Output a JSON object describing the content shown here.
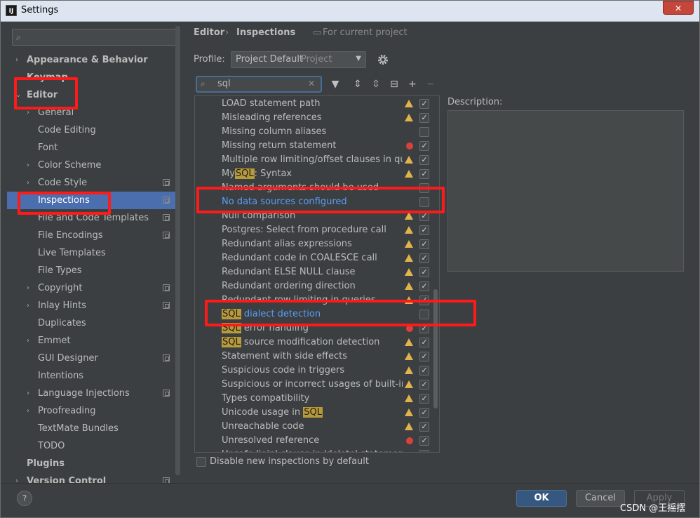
{
  "window": {
    "title": "Settings",
    "logo": "IJ",
    "close": "✕"
  },
  "sidebar": {
    "search_placeholder": "",
    "items": [
      {
        "label": "Appearance & Behavior",
        "level": 0,
        "arrow": "›",
        "bold": true
      },
      {
        "label": "Keymap",
        "level": 0,
        "bold": true
      },
      {
        "label": "Editor",
        "level": 0,
        "arrow": "⌄",
        "bold": true
      },
      {
        "label": "General",
        "level": 1,
        "arrow": "›"
      },
      {
        "label": "Code Editing",
        "level": 1
      },
      {
        "label": "Font",
        "level": 1
      },
      {
        "label": "Color Scheme",
        "level": 1,
        "arrow": "›"
      },
      {
        "label": "Code Style",
        "level": 1,
        "arrow": "›",
        "project": true
      },
      {
        "label": "Inspections",
        "level": 1,
        "project": true,
        "selected": true
      },
      {
        "label": "File and Code Templates",
        "level": 1,
        "project": true
      },
      {
        "label": "File Encodings",
        "level": 1,
        "project": true
      },
      {
        "label": "Live Templates",
        "level": 1
      },
      {
        "label": "File Types",
        "level": 1
      },
      {
        "label": "Copyright",
        "level": 1,
        "arrow": "›",
        "project": true
      },
      {
        "label": "Inlay Hints",
        "level": 1,
        "arrow": "›",
        "project": true
      },
      {
        "label": "Duplicates",
        "level": 1
      },
      {
        "label": "Emmet",
        "level": 1,
        "arrow": "›"
      },
      {
        "label": "GUI Designer",
        "level": 1,
        "project": true
      },
      {
        "label": "Intentions",
        "level": 1
      },
      {
        "label": "Language Injections",
        "level": 1,
        "arrow": "›",
        "project": true
      },
      {
        "label": "Proofreading",
        "level": 1,
        "arrow": "›"
      },
      {
        "label": "TextMate Bundles",
        "level": 1
      },
      {
        "label": "TODO",
        "level": 1
      },
      {
        "label": "Plugins",
        "level": 0,
        "bold": true
      },
      {
        "label": "Version Control",
        "level": 0,
        "arrow": "›",
        "bold": true,
        "project": true
      }
    ]
  },
  "breadcrumb": {
    "part1": "Editor",
    "sep": "›",
    "part2": "Inspections",
    "scope": "For current project"
  },
  "profile": {
    "label": "Profile:",
    "value": "Project Default",
    "kind": "Project"
  },
  "filter": {
    "value": "sql",
    "clear": "✕"
  },
  "inspections": [
    {
      "pre": "LOAD statement path",
      "sev": "warn",
      "checked": true
    },
    {
      "pre": "Misleading references",
      "sev": "warn",
      "checked": true
    },
    {
      "pre": "Missing column aliases",
      "sev": "",
      "checked": false
    },
    {
      "pre": "Missing return statement",
      "sev": "err",
      "checked": true
    },
    {
      "pre": "Multiple row limiting/offset clauses in queries",
      "sev": "warn",
      "checked": true
    },
    {
      "pre": "My",
      "hl": "SQL",
      "post": ": Syntax",
      "sev": "warn",
      "checked": true
    },
    {
      "pre": "Named arguments should be used",
      "sev": "",
      "checked": false
    },
    {
      "pre": "No data sources configured",
      "sev": "",
      "checked": false,
      "link": true
    },
    {
      "pre": "Null comparison",
      "sev": "warn",
      "checked": true
    },
    {
      "pre": "Postgres: Select from procedure call",
      "sev": "warn",
      "checked": true
    },
    {
      "pre": "Redundant alias expressions",
      "sev": "warn",
      "checked": true
    },
    {
      "pre": "Redundant code in COALESCE call",
      "sev": "warn",
      "checked": true
    },
    {
      "pre": "Redundant ELSE NULL clause",
      "sev": "warn",
      "checked": true
    },
    {
      "pre": "Redundant ordering direction",
      "sev": "warn",
      "checked": true
    },
    {
      "pre": "Redundant row limiting in queries",
      "sev": "warn",
      "checked": true
    },
    {
      "pre": "",
      "hl": "SQL",
      "post": " dialect detection",
      "sev": "",
      "checked": false,
      "link": true
    },
    {
      "pre": "",
      "hl": "SQL",
      "post": " error handling",
      "sev": "err",
      "checked": true
    },
    {
      "pre": "",
      "hl": "SQL",
      "post": " source modification detection",
      "sev": "warn",
      "checked": true
    },
    {
      "pre": "Statement with side effects",
      "sev": "warn",
      "checked": true
    },
    {
      "pre": "Suspicious code in triggers",
      "sev": "warn",
      "checked": true
    },
    {
      "pre": "Suspicious or incorrect usages of built-in functions",
      "sev": "warn",
      "checked": true
    },
    {
      "pre": "Types compatibility",
      "sev": "warn",
      "checked": true
    },
    {
      "pre": "Unicode usage in ",
      "hl": "SQL",
      "post": "",
      "sev": "warn",
      "checked": true
    },
    {
      "pre": "Unreachable code",
      "sev": "warn",
      "checked": true
    },
    {
      "pre": "Unresolved reference",
      "sev": "err",
      "checked": true
    },
    {
      "pre": "Unsafe 'join' clause in 'delete' statement",
      "sev": "",
      "checked": true
    }
  ],
  "disable_new": {
    "label": "Disable new inspections by default",
    "checked": false
  },
  "description": {
    "label": "Description:"
  },
  "buttons": {
    "ok": "OK",
    "cancel": "Cancel",
    "apply": "Apply",
    "help": "?"
  },
  "watermark": "CSDN @王摇摆",
  "colors": {
    "selection": "#4b6eaf",
    "annotation": "#ff1a1a",
    "link": "#589df6",
    "highlight": "#b89a3a"
  }
}
